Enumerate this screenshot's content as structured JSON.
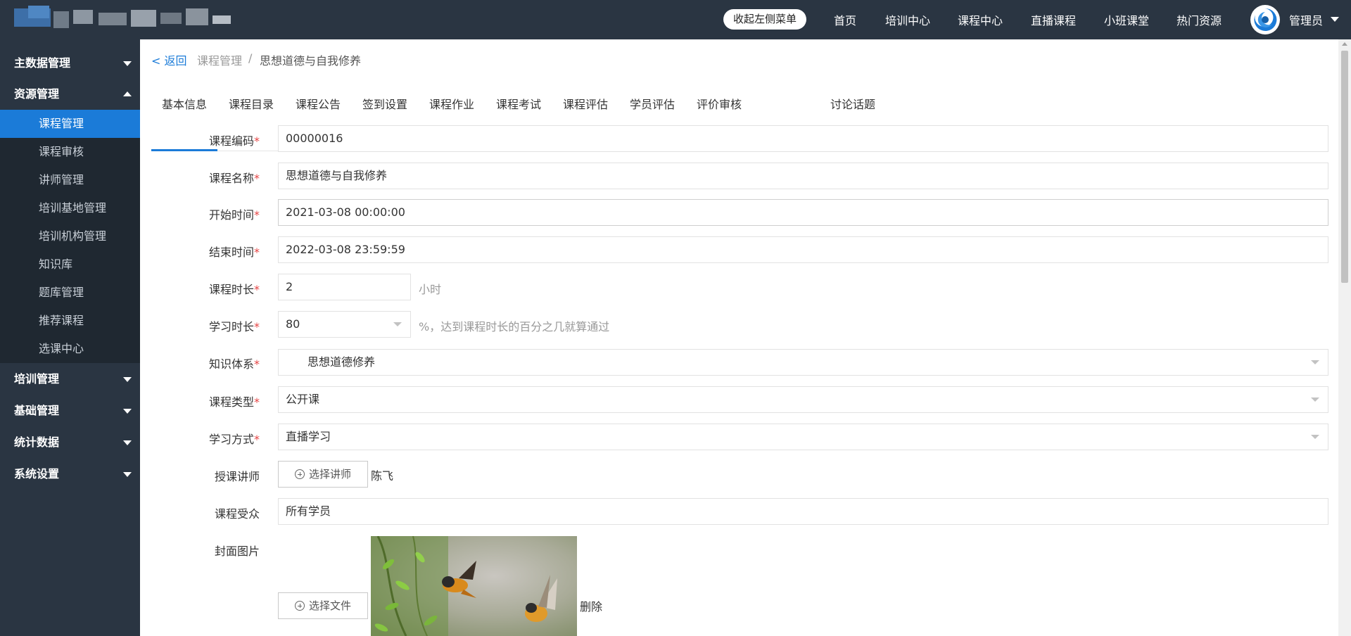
{
  "topbar": {
    "collapse_label": "收起左侧菜单",
    "nav": [
      "首页",
      "培训中心",
      "课程中心",
      "直播课程",
      "小班课堂",
      "热门资源"
    ],
    "user": "管理员"
  },
  "sidebar": {
    "groups_top": [
      {
        "label": "主数据管理",
        "expanded": false
      },
      {
        "label": "资源管理",
        "expanded": true
      }
    ],
    "sub_items": [
      "课程管理",
      "课程审核",
      "讲师管理",
      "培训基地管理",
      "培训机构管理",
      "知识库",
      "题库管理",
      "推荐课程",
      "选课中心"
    ],
    "active_sub": "课程管理",
    "groups_bottom": [
      "培训管理",
      "基础管理",
      "统计数据",
      "系统设置"
    ]
  },
  "breadcrumb": {
    "back": "< 返回",
    "level1": "课程管理",
    "separator": "/",
    "level2": "思想道德与自我修养"
  },
  "tabs": [
    "基本信息",
    "课程目录",
    "课程公告",
    "签到设置",
    "课程作业",
    "课程考试",
    "课程评估",
    "学员评估",
    "评价审核",
    "讨论话题"
  ],
  "active_tab": "基本信息",
  "form": {
    "code": {
      "label": "课程编码",
      "value": "00000016"
    },
    "name": {
      "label": "课程名称",
      "value": "思想道德与自我修养"
    },
    "start": {
      "label": "开始时间",
      "value": "2021-03-08 00:00:00"
    },
    "end": {
      "label": "结束时间",
      "value": "2022-03-08 23:59:59"
    },
    "duration": {
      "label": "课程时长",
      "value": "2",
      "unit": "小时"
    },
    "study": {
      "label": "学习时长",
      "value": "80",
      "hint": "%，达到课程时长的百分之几就算通过"
    },
    "knowledge": {
      "label": "知识体系",
      "value": "思想道德修养"
    },
    "type": {
      "label": "课程类型",
      "value": "公开课"
    },
    "mode": {
      "label": "学习方式",
      "value": "直播学习"
    },
    "teacher": {
      "label": "授课讲师",
      "button": "选择讲师",
      "value": "陈飞"
    },
    "audience": {
      "label": "课程受众",
      "value": "所有学员"
    },
    "cover": {
      "label": "封面图片",
      "button": "选择文件",
      "delete": "删除"
    }
  },
  "colors": {
    "topbar_bg": "#2a3542",
    "accent": "#1b7bd8",
    "required": "#e64545"
  }
}
